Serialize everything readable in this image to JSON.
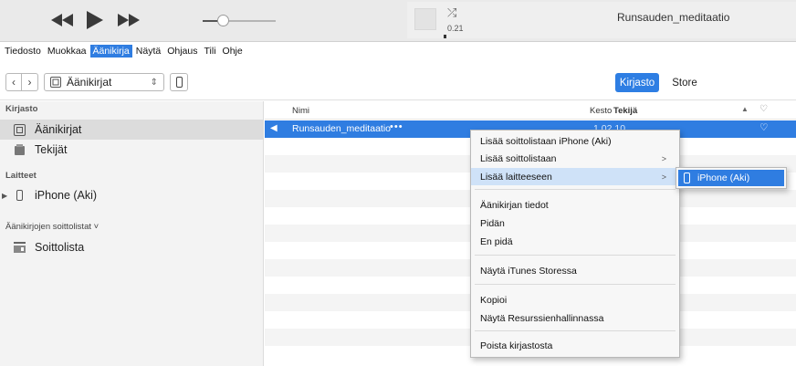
{
  "player": {
    "prev_icon": "rewind-icon",
    "play_icon": "play-icon",
    "next_icon": "fast-forward-icon",
    "elapsed": "0.21",
    "track_title": "Runsauden_meditaatio",
    "volume_fraction": 0.25
  },
  "menubar": {
    "items": [
      "Tiedosto",
      "Muokkaa",
      "Äänikirja",
      "Näytä",
      "Ohjaus",
      "Tili",
      "Ohje"
    ],
    "active_index": 2
  },
  "navbar": {
    "media_kind": "Äänikirjat",
    "tabs": [
      "Kirjasto",
      "Store"
    ]
  },
  "sidebar": {
    "library_header": "Kirjasto",
    "library_items": [
      "Äänikirjat",
      "Tekijät"
    ],
    "devices_header": "Laitteet",
    "device": "iPhone (Aki)",
    "playlists_header": "Äänikirjojen soittolistat ˅",
    "playlist": "Soittolista"
  },
  "list": {
    "columns": {
      "name": "Nimi",
      "duration": "Kesto",
      "author": "Tekijä"
    },
    "selected_row": {
      "name": "Runsauden_meditaatio",
      "dots": "•••",
      "duration": "1.02.10"
    }
  },
  "context_menu": {
    "items": [
      "Lisää soittolistaan iPhone (Aki)",
      "Lisää soittolistaan",
      "Lisää laitteeseen",
      "Äänikirjan tiedot",
      "Pidän",
      "En pidä",
      "Näytä iTunes Storessa",
      "Kopioi",
      "Näytä Resurssienhallinnassa",
      "Poista kirjastosta"
    ],
    "highlighted_index": 2,
    "submenu_item": "iPhone (Aki)"
  },
  "colors": {
    "accent": "#2f7de1",
    "highlight": "#cfe2f8",
    "sidebar_bg": "#f3f3f3"
  }
}
